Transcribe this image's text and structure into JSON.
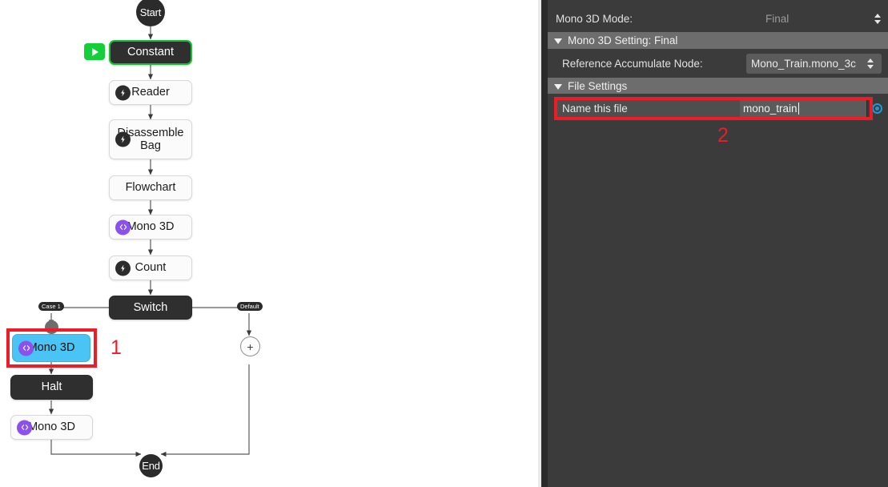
{
  "canvas": {
    "start_node": "Start",
    "end_node": "End",
    "plus_label": "+",
    "run_button": "run-node",
    "nodes": [
      {
        "id": "constant",
        "label": "Constant",
        "style": "dark-green",
        "icon": "none"
      },
      {
        "id": "reader",
        "label": "Reader",
        "style": "light",
        "icon": "black-bolt"
      },
      {
        "id": "disassemble_bag",
        "label": "Disassemble Bag",
        "style": "light",
        "icon": "black-bolt"
      },
      {
        "id": "flowchart",
        "label": "Flowchart",
        "style": "light",
        "icon": "none"
      },
      {
        "id": "mono3d_top",
        "label": "Mono 3D",
        "style": "light",
        "icon": "purple-code"
      },
      {
        "id": "count",
        "label": "Count",
        "style": "light",
        "icon": "black-bolt"
      },
      {
        "id": "switch",
        "label": "Switch",
        "style": "dark",
        "icon": "none"
      },
      {
        "id": "mono3d_selected",
        "label": "Mono 3D",
        "style": "selected",
        "icon": "purple-code"
      },
      {
        "id": "halt",
        "label": "Halt",
        "style": "dark",
        "icon": "none"
      },
      {
        "id": "mono3d_bottom",
        "label": "Mono 3D",
        "style": "light",
        "icon": "purple-code"
      }
    ],
    "port_labels": {
      "case1": "Case 1",
      "default": "Default"
    },
    "annotations": [
      {
        "id": "annot-1",
        "text": "1"
      },
      {
        "id": "annot-2",
        "text": "2"
      }
    ],
    "colors": {
      "selected_node": "#49c4f5",
      "run_green": "#15cf3a",
      "annotation_red": "#ee1c26",
      "purple_icon": "#8b51ef"
    }
  },
  "panel": {
    "mode_row": {
      "label": "Mono 3D Mode:",
      "value": "Final"
    },
    "group_setting": {
      "label": "Mono 3D Setting: Final"
    },
    "reference_row": {
      "label": "Reference Accumulate Node:",
      "value": "Mono_Train.mono_3c"
    },
    "group_file": {
      "label": "File Settings"
    },
    "file_row": {
      "label": "Name this file",
      "value": "mono_train"
    }
  }
}
